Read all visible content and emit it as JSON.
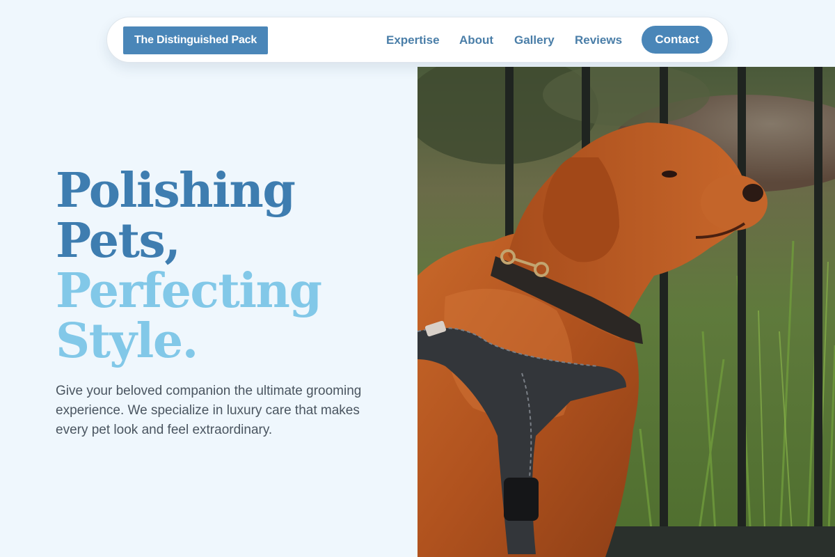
{
  "nav": {
    "brand": "The Distinguished Pack",
    "links": [
      {
        "label": "Expertise"
      },
      {
        "label": "About"
      },
      {
        "label": "Gallery"
      },
      {
        "label": "Reviews"
      }
    ],
    "contact_label": "Contact"
  },
  "hero": {
    "headline_line1": "Polishing",
    "headline_line2": "Pets,",
    "headline_line3": "Perfecting",
    "headline_line4": "Style.",
    "description": "Give your beloved companion the ultimate grooming experience. We specialize in luxury care that makes every pet look and feel extraordinary.",
    "image": {
      "subject": "dog-photo"
    }
  },
  "colors": {
    "page_background": "#eff7fd",
    "accent": "#4a86b8",
    "headline_dark": "#3e7db0",
    "headline_light": "#82c8e8",
    "body_text": "#4a5560"
  }
}
